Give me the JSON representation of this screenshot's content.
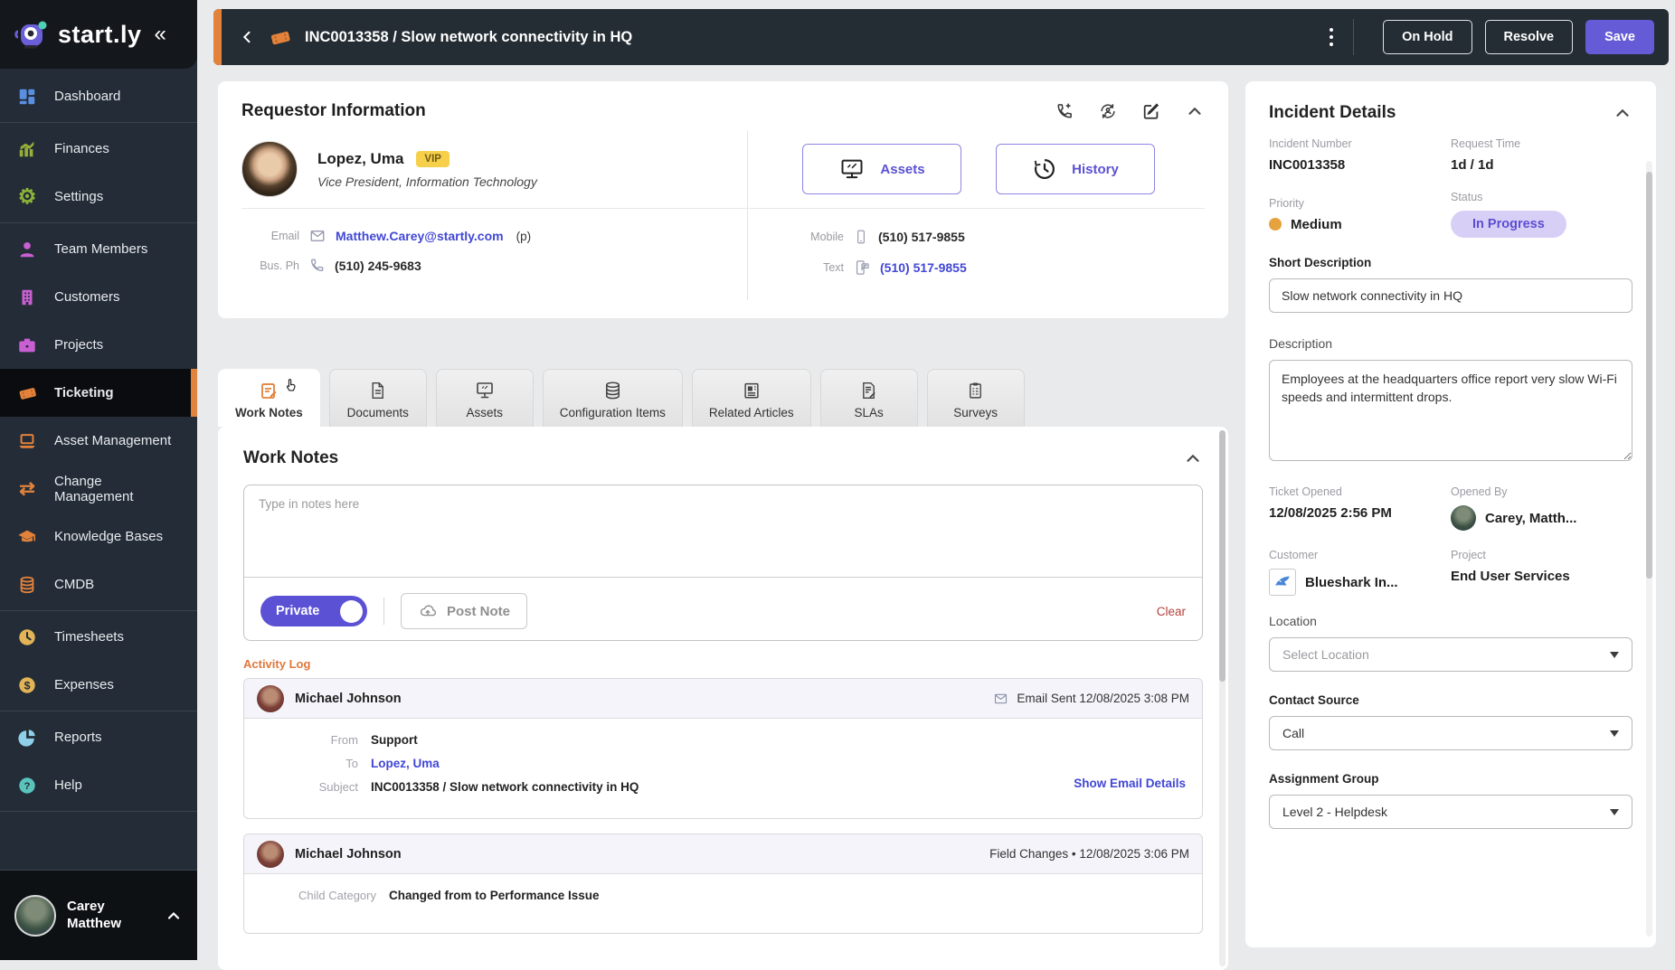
{
  "colors": {
    "accent_purple": "#655bd6",
    "accent_orange": "#e2823b",
    "link_blue": "#4147d5",
    "status_bg": "#d8cff7",
    "status_text": "#5b4ed1",
    "priority_dot": "#e6a23c",
    "vip_bg": "#f6d04a"
  },
  "sidebar": {
    "logo_text": "start.ly",
    "collapse_glyph": "«",
    "items": [
      {
        "label": "Dashboard"
      },
      {
        "label": "Finances"
      },
      {
        "label": "Settings"
      },
      {
        "label": "Team Members"
      },
      {
        "label": "Customers"
      },
      {
        "label": "Projects"
      },
      {
        "label": "Ticketing"
      },
      {
        "label": "Asset Management"
      },
      {
        "label": "Change Management"
      },
      {
        "label": "Knowledge Bases"
      },
      {
        "label": "CMDB"
      },
      {
        "label": "Timesheets"
      },
      {
        "label": "Expenses"
      },
      {
        "label": "Reports"
      },
      {
        "label": "Help"
      }
    ],
    "user": {
      "first": "Carey",
      "last": "Matthew"
    }
  },
  "header": {
    "title": "INC0013358 / Slow network connectivity in HQ",
    "on_hold": "On Hold",
    "resolve": "Resolve",
    "save": "Save"
  },
  "requestor": {
    "section_title": "Requestor Information",
    "name": "Lopez, Uma",
    "vip_badge": "VIP",
    "job_title": "Vice President, Information Technology",
    "email_label": "Email",
    "email": "Matthew.Carey@startly.com",
    "email_suffix": "(p)",
    "bus_ph_label": "Bus. Ph",
    "bus_ph": "(510) 245-9683",
    "mobile_label": "Mobile",
    "mobile": "(510) 517-9855",
    "text_label": "Text",
    "text": "(510) 517-9855",
    "assets_button": "Assets",
    "history_button": "History"
  },
  "tabs": [
    {
      "label": "Work Notes"
    },
    {
      "label": "Documents"
    },
    {
      "label": "Assets"
    },
    {
      "label": "Configuration Items"
    },
    {
      "label": "Related Articles"
    },
    {
      "label": "SLAs"
    },
    {
      "label": "Surveys"
    }
  ],
  "work_notes": {
    "section_title": "Work Notes",
    "placeholder": "Type in notes here",
    "private_label": "Private",
    "post_note": "Post Note",
    "clear": "Clear",
    "activity_log_label": "Activity Log"
  },
  "activity": {
    "entries": [
      {
        "author": "Michael Johnson",
        "meta": "Email Sent 12/08/2025 3:08 PM",
        "rows": [
          {
            "label": "From",
            "value": "Support"
          },
          {
            "label": "To",
            "value": "Lopez, Uma"
          },
          {
            "label": "Subject",
            "value": "INC0013358 / Slow network connectivity in HQ"
          }
        ],
        "action": "Show Email Details"
      },
      {
        "author": "Michael Johnson",
        "meta": "Field Changes • 12/08/2025 3:06 PM",
        "rows": [
          {
            "label": "Child Category",
            "value": "Changed from to Performance Issue"
          }
        ]
      }
    ]
  },
  "incident": {
    "section_title": "Incident Details",
    "incident_number_label": "Incident Number",
    "incident_number": "INC0013358",
    "request_time_label": "Request Time",
    "request_time": "1d / 1d",
    "priority_label": "Priority",
    "priority": "Medium",
    "status_label": "Status",
    "status": "In Progress",
    "short_description_label": "Short Description",
    "short_description": "Slow network connectivity in HQ",
    "description_label": "Description",
    "description": "Employees at the headquarters office report very slow Wi-Fi speeds and intermittent drops.",
    "ticket_opened_label": "Ticket Opened",
    "ticket_opened": "12/08/2025 2:56 PM",
    "opened_by_label": "Opened By",
    "opened_by": "Carey, Matth...",
    "customer_label": "Customer",
    "customer": "Blueshark In...",
    "project_label": "Project",
    "project": "End User Services",
    "location_label": "Location",
    "location_placeholder": "Select Location",
    "contact_source_label": "Contact Source",
    "contact_source": "Call",
    "assignment_group_label": "Assignment Group",
    "assignment_group": "Level 2 - Helpdesk"
  }
}
